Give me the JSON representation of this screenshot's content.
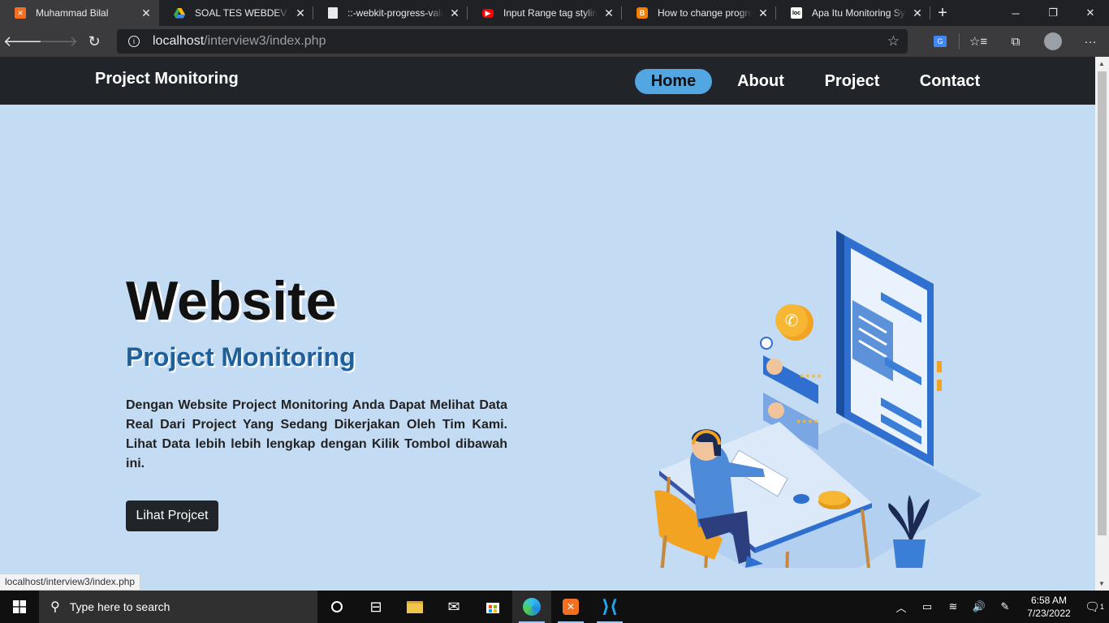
{
  "browser": {
    "tabs": [
      {
        "title": "Muhammad Bilal",
        "favicon": "xampp-icon",
        "color": "#f36f21",
        "active": true
      },
      {
        "title": "SOAL TES WEBDEV DIG",
        "favicon": "google-drive-icon",
        "color": "#34a853",
        "active": false
      },
      {
        "title": "::-webkit-progress-valu",
        "favicon": "document-icon",
        "color": "#e8eaed",
        "active": false
      },
      {
        "title": "Input Range tag styling",
        "favicon": "youtube-icon",
        "color": "#ff0000",
        "active": false
      },
      {
        "title": "How to change progres",
        "favicon": "blogger-icon",
        "color": "#f57d00",
        "active": false
      },
      {
        "title": "Apa Itu Monitoring Syst",
        "favicon": "loc-icon",
        "color": "#ffffff",
        "active": false
      }
    ],
    "url_host": "localhost",
    "url_path": "/interview3/index.php",
    "status_url": "localhost/interview3/index.php"
  },
  "site": {
    "brand": "Project Monitoring",
    "nav": [
      {
        "label": "Home",
        "active": true
      },
      {
        "label": "About",
        "active": false
      },
      {
        "label": "Project",
        "active": false
      },
      {
        "label": "Contact",
        "active": false
      }
    ],
    "hero": {
      "title": "Website",
      "subtitle": "Project Monitoring",
      "description": "Dengan Website Project Monitoring Anda Dapat Melihat Data Real Dari Project Yang Sedang Dikerjakan Oleh Tim Kami. Lihat Data lebih lebih lengkap dengan Kilik Tombol dibawah ini.",
      "cta_label": "Lihat Projcet"
    },
    "colors": {
      "navbar": "#212529",
      "hero_bg": "#c4dcf3",
      "accent": "#52a6e2",
      "subtitle": "#1f5f9a"
    }
  },
  "taskbar": {
    "search_placeholder": "Type here to search",
    "time": "6:58 AM",
    "date": "7/23/2022",
    "notifications": "1"
  }
}
